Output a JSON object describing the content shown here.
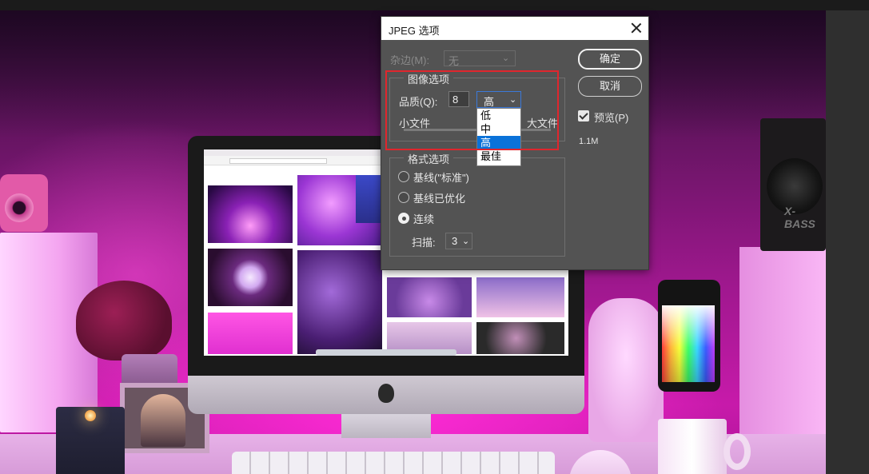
{
  "dialog": {
    "title": "JPEG 选项",
    "matte": {
      "label": "杂边(M):",
      "value": "无"
    },
    "image_options": {
      "group_label": "图像选项",
      "quality_label": "品质(Q):",
      "quality_value": "8",
      "quality_selected": "高",
      "quality_options": [
        "低",
        "中",
        "高",
        "最佳"
      ],
      "small_file_label": "小文件",
      "large_file_label": "大文件"
    },
    "format_options": {
      "group_label": "格式选项",
      "baseline_standard": "基线(\"标准\")",
      "baseline_optimized": "基线已优化",
      "progressive": "连续",
      "selected": "连续",
      "scans_label": "扫描:",
      "scans_value": "3"
    },
    "buttons": {
      "ok": "确定",
      "cancel": "取消"
    },
    "preview": {
      "label": "预览(P)",
      "checked": true
    },
    "file_size": "1.1M"
  },
  "background": {
    "speaker_brand": "X-BASS"
  },
  "colors": {
    "dialog_bg": "#535353",
    "highlight_blue": "#0a72d9",
    "annotation_red": "#e0262d",
    "ambient_magenta": "#c71aaa"
  },
  "icons": [
    "close-icon",
    "chevron-down-icon",
    "checkmark-icon"
  ]
}
